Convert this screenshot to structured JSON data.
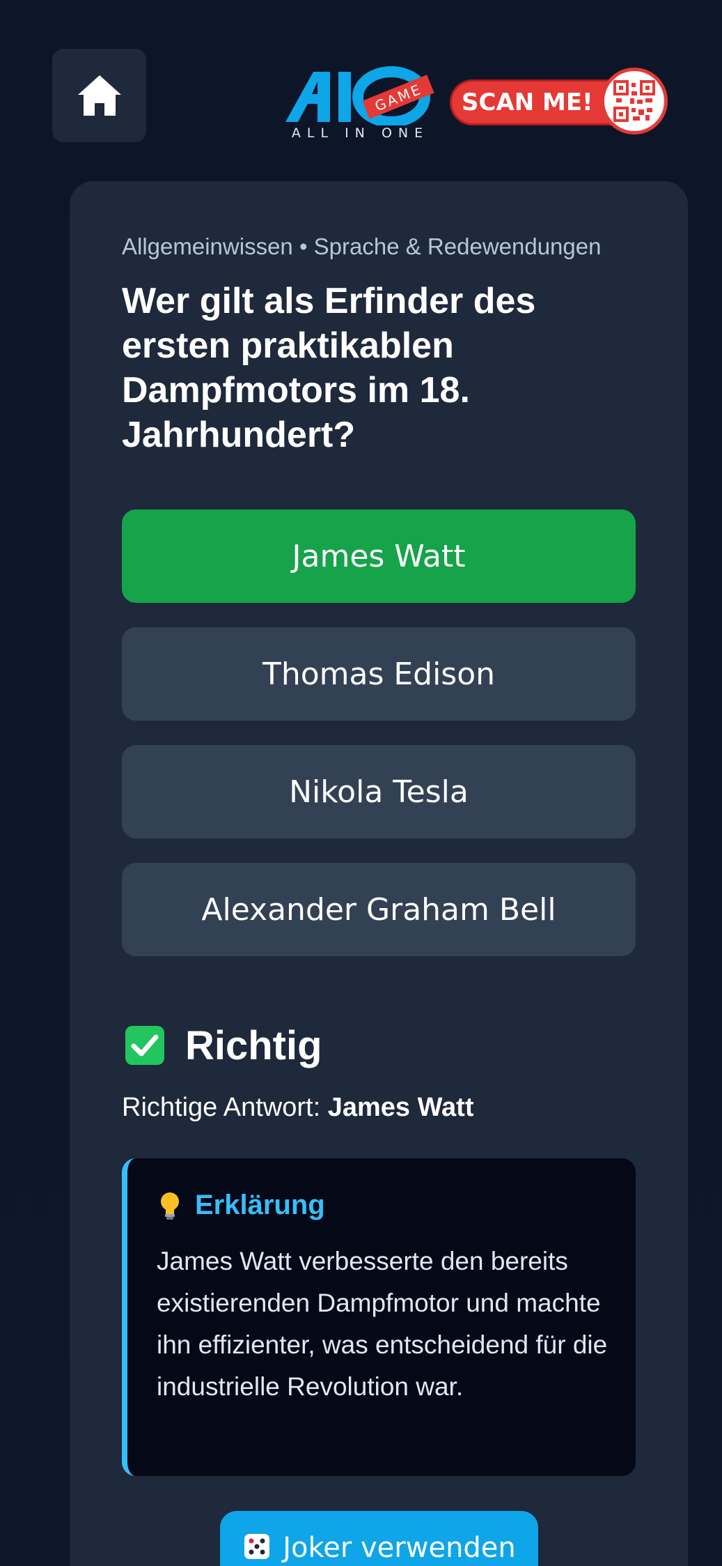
{
  "header": {
    "home_icon": "home-icon",
    "logo": {
      "main": "AIO",
      "tag": "GAME",
      "sub": "ALL IN ONE"
    },
    "scan": {
      "label": "SCAN ME!",
      "icon": "qr-code-icon"
    }
  },
  "quiz": {
    "category": "Allgemeinwissen • Sprache & Redewendungen",
    "question": "Wer gilt als Erfinder des ersten praktikablen Dampfmotors im 18. Jahrhundert?",
    "answers": [
      {
        "label": "James Watt",
        "state": "correct"
      },
      {
        "label": "Thomas Edison",
        "state": "neutral"
      },
      {
        "label": "Nikola Tesla",
        "state": "neutral"
      },
      {
        "label": "Alexander Graham Bell",
        "state": "neutral"
      }
    ]
  },
  "result": {
    "icon": "check-mark-icon",
    "title": "Richtig",
    "correct_prefix": "Richtige Antwort: ",
    "correct_value": "James Watt"
  },
  "explanation": {
    "icon": "lightbulb-icon",
    "title": "Erklärung",
    "text": "James Watt verbesserte den bereits existierenden Dampfmotor und machte ihn effizienter, was entscheidend für die industrielle Revolution war."
  },
  "joker": {
    "icon": "dice-icon",
    "label": "Joker verwenden"
  },
  "colors": {
    "background": "#0f172a",
    "card": "#1e293b",
    "answer": "#334155",
    "correct": "#16a34a",
    "accent": "#38bdf8",
    "joker": "#0ea5e9",
    "scan": "#e53935"
  }
}
